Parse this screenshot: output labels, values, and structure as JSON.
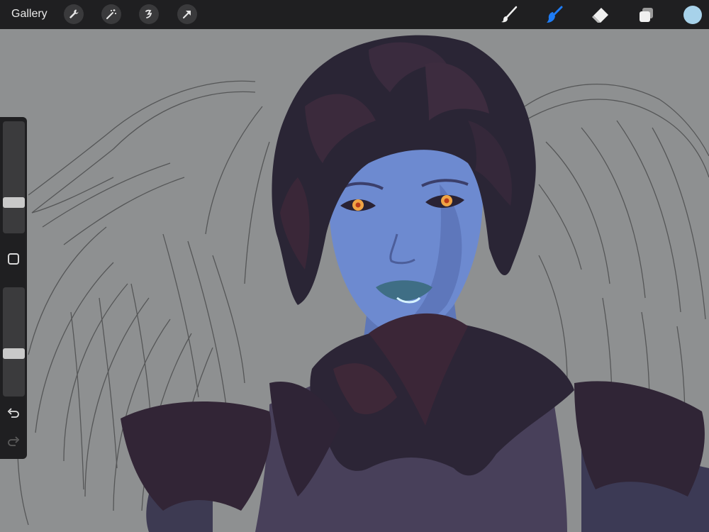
{
  "topbar": {
    "gallery_label": "Gallery",
    "left_tools": [
      "wrench-icon",
      "magic-wand-icon",
      "selection-icon",
      "transform-arrow-icon"
    ],
    "right_tools": [
      "brush-icon",
      "smudge-icon",
      "eraser-icon",
      "layers-icon"
    ],
    "active_tool": "smudge",
    "active_color": "#a7d2ea",
    "accent_color": "#1e7cf5"
  },
  "sidebar": {
    "brush_size_level": 0.25,
    "opacity_level": 0.38
  }
}
